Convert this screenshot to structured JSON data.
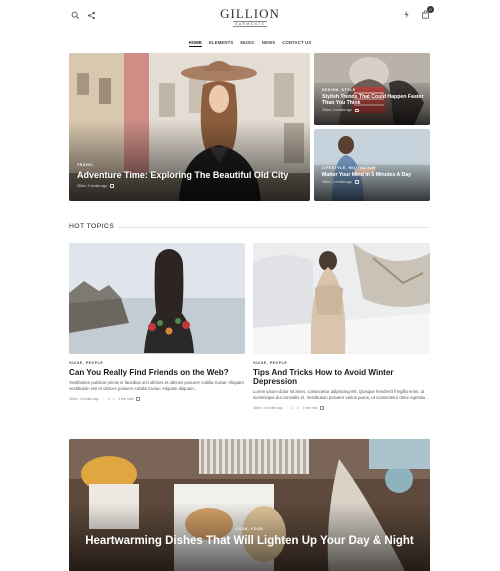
{
  "header": {
    "logo": "GILLION",
    "logo_tagline": "GARMENTS",
    "cart_count": "0",
    "icons": {
      "search": "search-icon",
      "share": "share-icon",
      "bolt": "lightning-icon",
      "cart": "shopping-bag-icon"
    }
  },
  "nav": {
    "items": [
      "HOME",
      "ELEMENTS",
      "MUSIC",
      "NEWS",
      "CONTACT US"
    ]
  },
  "hero": {
    "main": {
      "category": "TRAVEL",
      "title": "Adventure Time: Exploring The Beautiful Old City",
      "meta": "Gillion, 3 months ago"
    },
    "side1": {
      "category": "DESIGN, STYLE",
      "title": "Stylish Trends That Could Happen Faster Than You Think",
      "meta": "Gillion, 3 months ago"
    },
    "side2": {
      "category": "LIFESTYLE, MOTIVATION",
      "title": "Matter Your Mind In 5 Minutes A Day",
      "meta": "Gillion, 3 months ago"
    }
  },
  "hot_topics": {
    "title": "HOT TOPICS",
    "cards": [
      {
        "category": "GUIDE, PEOPLE",
        "title": "Can You Really Find Friends on the Web?",
        "excerpt": "Vestibulum pulvinar primis in faucibus orci ultrices et ultrices posuere cubilia Curae; Aliquam vestibulum nisi et ultrices posuere cubilia Curae; Aliquam aliquam...",
        "meta": "Gillion, 3 months ago",
        "comments": "0",
        "read_time": "2 min read"
      },
      {
        "category": "GUIDE, PEOPLE",
        "title": "Tips And Tricks How to Avoid Winter Depression",
        "excerpt": "Lorem ipsum dolor sit amet, consectetur adipiscing elit. Quisque hendrerit fringilla enim, ut scelerisque dui convallis et. Vestibulum posuere varius purus, ut consectetur dolor egestas...",
        "meta": "Gillion, 3 months ago",
        "comments": "1",
        "read_time": "2 min read"
      }
    ]
  },
  "feature": {
    "category": "COOK, FOOD",
    "title": "Heartwarming Dishes That Will Lighten Up Your Day & Night"
  }
}
